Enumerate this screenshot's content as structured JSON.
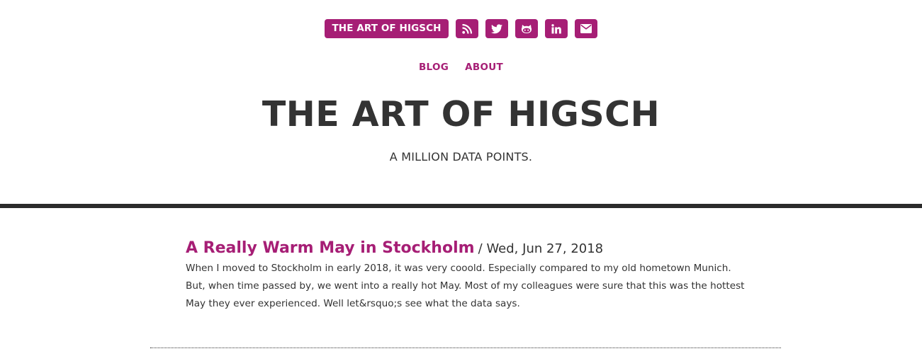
{
  "header": {
    "brand_label": "THE ART OF HIGSCH",
    "social_icons": [
      "rss-icon",
      "twitter-icon",
      "github-icon",
      "linkedin-icon",
      "envelope-icon"
    ],
    "accent_color": "#a61e75"
  },
  "nav": {
    "items": [
      {
        "label": "BLOG"
      },
      {
        "label": "ABOUT"
      }
    ]
  },
  "site": {
    "title": "THE ART OF HIGSCH",
    "subtitle": "A MILLION DATA POINTS."
  },
  "posts": [
    {
      "title": "A Really Warm May in Stockholm",
      "date": "/ Wed, Jun 27, 2018",
      "excerpt": "When I moved to Stockholm in early 2018, it was very cooold. Especially compared to my old hometown Munich. But, when time passed by, we went into a really hot May. Most of my colleagues were sure that this was the hottest May they ever experienced. Well let&rsquo;s see what the data says."
    }
  ]
}
